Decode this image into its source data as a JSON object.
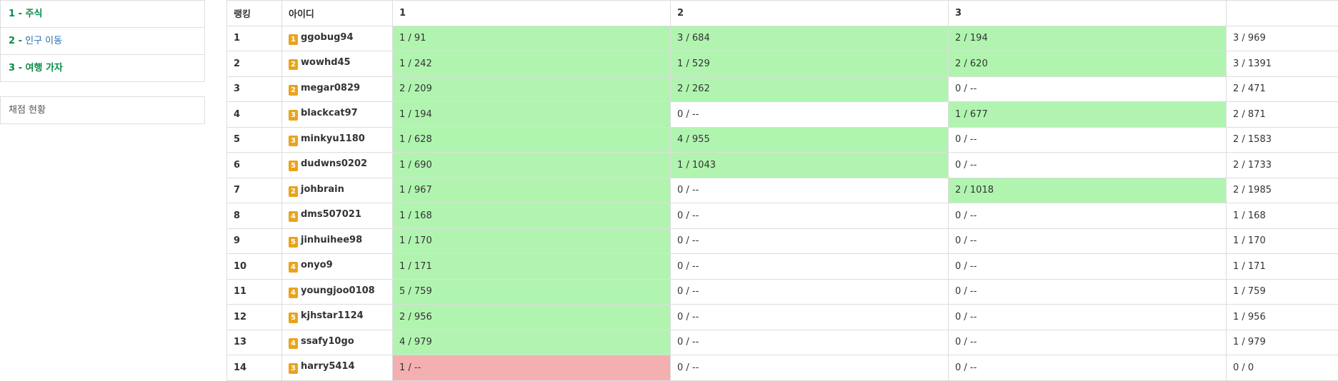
{
  "sidebar": {
    "problems": [
      {
        "num": "1 -",
        "title": "주식",
        "style": "green"
      },
      {
        "num": "2 -",
        "title": "인구 이동",
        "style": "blue"
      },
      {
        "num": "3 -",
        "title": "여행 가자",
        "style": "bold"
      }
    ],
    "status_label": "채점 현황"
  },
  "table": {
    "headers": [
      "랭킹",
      "아이디",
      "1",
      "2",
      "3",
      ""
    ],
    "rows": [
      {
        "rank": "1",
        "tier": "1",
        "user": "ggobug94",
        "p": [
          {
            "v": "1 / 91",
            "s": "ok"
          },
          {
            "v": "3 / 684",
            "s": "ok"
          },
          {
            "v": "2 / 194",
            "s": "ok"
          }
        ],
        "total": "3 / 969"
      },
      {
        "rank": "2",
        "tier": "2",
        "user": "wowhd45",
        "p": [
          {
            "v": "1 / 242",
            "s": "ok"
          },
          {
            "v": "1 / 529",
            "s": "ok"
          },
          {
            "v": "2 / 620",
            "s": "ok"
          }
        ],
        "total": "3 / 1391"
      },
      {
        "rank": "3",
        "tier": "2",
        "user": "megar0829",
        "p": [
          {
            "v": "2 / 209",
            "s": "ok"
          },
          {
            "v": "2 / 262",
            "s": "ok"
          },
          {
            "v": "0 / --",
            "s": ""
          }
        ],
        "total": "2 / 471"
      },
      {
        "rank": "4",
        "tier": "3",
        "user": "blackcat97",
        "p": [
          {
            "v": "1 / 194",
            "s": "ok"
          },
          {
            "v": "0 / --",
            "s": ""
          },
          {
            "v": "1 / 677",
            "s": "ok"
          }
        ],
        "total": "2 / 871"
      },
      {
        "rank": "5",
        "tier": "3",
        "user": "minkyu1180",
        "p": [
          {
            "v": "1 / 628",
            "s": "ok"
          },
          {
            "v": "4 / 955",
            "s": "ok"
          },
          {
            "v": "0 / --",
            "s": ""
          }
        ],
        "total": "2 / 1583"
      },
      {
        "rank": "6",
        "tier": "5",
        "user": "dudwns0202",
        "p": [
          {
            "v": "1 / 690",
            "s": "ok"
          },
          {
            "v": "1 / 1043",
            "s": "ok"
          },
          {
            "v": "0 / --",
            "s": ""
          }
        ],
        "total": "2 / 1733"
      },
      {
        "rank": "7",
        "tier": "2",
        "user": "johbrain",
        "p": [
          {
            "v": "1 / 967",
            "s": "ok"
          },
          {
            "v": "0 / --",
            "s": ""
          },
          {
            "v": "2 / 1018",
            "s": "ok"
          }
        ],
        "total": "2 / 1985"
      },
      {
        "rank": "8",
        "tier": "4",
        "user": "dms507021",
        "p": [
          {
            "v": "1 / 168",
            "s": "ok"
          },
          {
            "v": "0 / --",
            "s": ""
          },
          {
            "v": "0 / --",
            "s": ""
          }
        ],
        "total": "1 / 168"
      },
      {
        "rank": "9",
        "tier": "5",
        "user": "jinhuihee98",
        "p": [
          {
            "v": "1 / 170",
            "s": "ok"
          },
          {
            "v": "0 / --",
            "s": ""
          },
          {
            "v": "0 / --",
            "s": ""
          }
        ],
        "total": "1 / 170"
      },
      {
        "rank": "10",
        "tier": "4",
        "user": "onyo9",
        "p": [
          {
            "v": "1 / 171",
            "s": "ok"
          },
          {
            "v": "0 / --",
            "s": ""
          },
          {
            "v": "0 / --",
            "s": ""
          }
        ],
        "total": "1 / 171"
      },
      {
        "rank": "11",
        "tier": "4",
        "user": "youngjoo0108",
        "p": [
          {
            "v": "5 / 759",
            "s": "ok"
          },
          {
            "v": "0 / --",
            "s": ""
          },
          {
            "v": "0 / --",
            "s": ""
          }
        ],
        "total": "1 / 759"
      },
      {
        "rank": "12",
        "tier": "5",
        "user": "kjhstar1124",
        "p": [
          {
            "v": "2 / 956",
            "s": "ok"
          },
          {
            "v": "0 / --",
            "s": ""
          },
          {
            "v": "0 / --",
            "s": ""
          }
        ],
        "total": "1 / 956"
      },
      {
        "rank": "13",
        "tier": "4",
        "user": "ssafy10go",
        "p": [
          {
            "v": "4 / 979",
            "s": "ok"
          },
          {
            "v": "0 / --",
            "s": ""
          },
          {
            "v": "0 / --",
            "s": ""
          }
        ],
        "total": "1 / 979"
      },
      {
        "rank": "14",
        "tier": "3",
        "user": "harry5414",
        "p": [
          {
            "v": "1 / --",
            "s": "fail"
          },
          {
            "v": "0 / --",
            "s": ""
          },
          {
            "v": "0 / --",
            "s": ""
          }
        ],
        "total": "0 / 0"
      }
    ]
  },
  "colors": {
    "solved_bg": "#b0f4b0",
    "failed_bg": "#f4b0b0",
    "tier_badge": "#e8a41c",
    "link_green": "#0a8a4a",
    "link_blue": "#2a6fb5",
    "border": "#dddddd"
  },
  "icons": {
    "tier_badge": "shield-rank-icon"
  }
}
